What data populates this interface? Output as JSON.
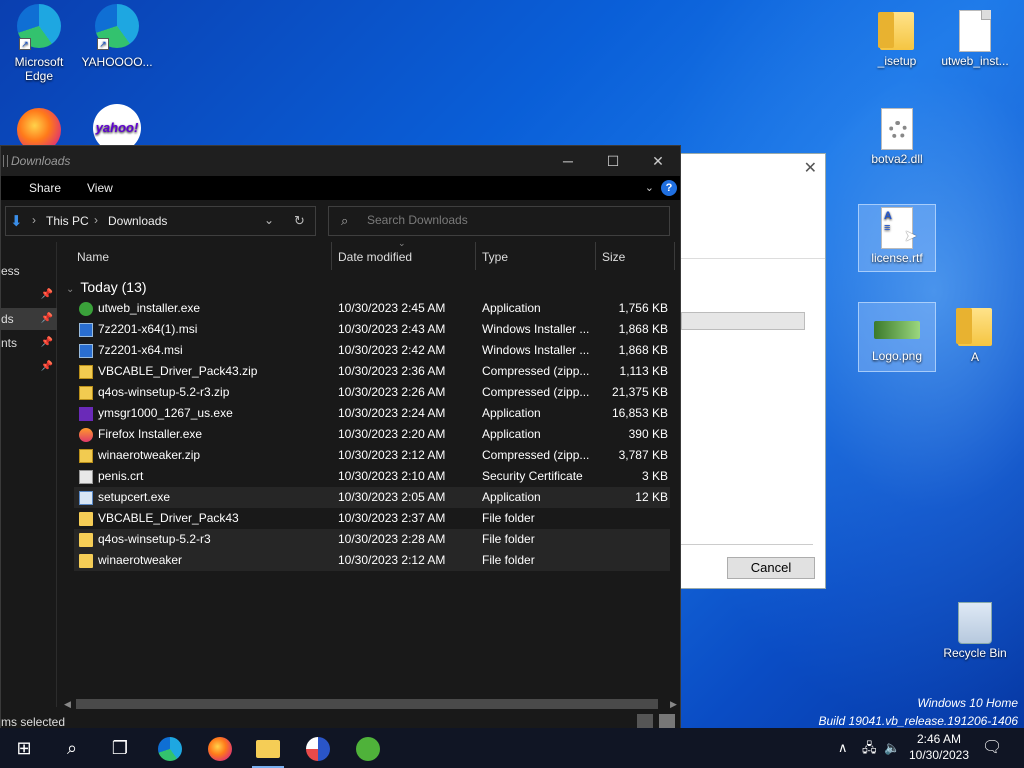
{
  "desktop": {
    "icons": [
      {
        "label": "Microsoft Edge"
      },
      {
        "label": "YAHOOOO..."
      },
      {
        "label": ""
      },
      {
        "label": "yahoo!"
      },
      {
        "label": "_isetup"
      },
      {
        "label": "utweb_inst..."
      },
      {
        "label": "botva2.dll"
      },
      {
        "label": "license.rtf"
      },
      {
        "label": "Logo.png"
      },
      {
        "label": "A"
      },
      {
        "label": "Recycle Bin"
      }
    ],
    "watermark": {
      "line1": "Windows 10 Home",
      "line2": "Build 19041.vb_release.191206-1406"
    }
  },
  "dialog": {
    "close": "✕",
    "cancel_label": "Cancel"
  },
  "explorer": {
    "title": "Downloads",
    "controls": {
      "minimize": "─",
      "maximize": "☐",
      "close": "✕"
    },
    "ribbon": {
      "share": "Share",
      "view": "View",
      "help": "?"
    },
    "address": {
      "this_pc": "This PC",
      "downloads": "Downloads"
    },
    "search": {
      "placeholder": "Search Downloads"
    },
    "nav": [
      {
        "label": "ess"
      },
      {
        "label": ""
      },
      {
        "label": "ds"
      },
      {
        "label": "nts"
      },
      {
        "label": ""
      }
    ],
    "columns": {
      "name": "Name",
      "date": "Date modified",
      "type": "Type",
      "size": "Size"
    },
    "group": "Today (13)",
    "files": [
      {
        "name": "utweb_installer.exe",
        "date": "10/30/2023 2:45 AM",
        "type": "Application",
        "size": "1,756 KB",
        "icon": "app-icon"
      },
      {
        "name": "7z2201-x64(1).msi",
        "date": "10/30/2023 2:43 AM",
        "type": "Windows Installer ...",
        "size": "1,868 KB",
        "icon": "msi-icon"
      },
      {
        "name": "7z2201-x64.msi",
        "date": "10/30/2023 2:42 AM",
        "type": "Windows Installer ...",
        "size": "1,868 KB",
        "icon": "msi-icon"
      },
      {
        "name": "VBCABLE_Driver_Pack43.zip",
        "date": "10/30/2023 2:36 AM",
        "type": "Compressed (zipp...",
        "size": "1,113 KB",
        "icon": "zip-icon"
      },
      {
        "name": "q4os-winsetup-5.2-r3.zip",
        "date": "10/30/2023 2:26 AM",
        "type": "Compressed (zipp...",
        "size": "21,375 KB",
        "icon": "zip-icon"
      },
      {
        "name": "ymsgr1000_1267_us.exe",
        "date": "10/30/2023 2:24 AM",
        "type": "Application",
        "size": "16,853 KB",
        "icon": "ym-icon"
      },
      {
        "name": "Firefox Installer.exe",
        "date": "10/30/2023 2:20 AM",
        "type": "Application",
        "size": "390 KB",
        "icon": "firefox-icon"
      },
      {
        "name": "winaerotweaker.zip",
        "date": "10/30/2023 2:12 AM",
        "type": "Compressed (zipp...",
        "size": "3,787 KB",
        "icon": "zip-icon"
      },
      {
        "name": "penis.crt",
        "date": "10/30/2023 2:10 AM",
        "type": "Security Certificate",
        "size": "3 KB",
        "icon": "certificate-icon"
      },
      {
        "name": "setupcert.exe",
        "date": "10/30/2023 2:05 AM",
        "type": "Application",
        "size": "12 KB",
        "icon": "setup-icon"
      },
      {
        "name": "VBCABLE_Driver_Pack43",
        "date": "10/30/2023 2:37 AM",
        "type": "File folder",
        "size": "",
        "icon": "folder-icon"
      },
      {
        "name": "q4os-winsetup-5.2-r3",
        "date": "10/30/2023 2:28 AM",
        "type": "File folder",
        "size": "",
        "icon": "folder-icon"
      },
      {
        "name": "winaerotweaker",
        "date": "10/30/2023 2:12 AM",
        "type": "File folder",
        "size": "",
        "icon": "folder-icon"
      }
    ],
    "status": "ms selected"
  },
  "taskbar": {
    "clock_time": "2:46 AM",
    "clock_date": "10/30/2023"
  }
}
